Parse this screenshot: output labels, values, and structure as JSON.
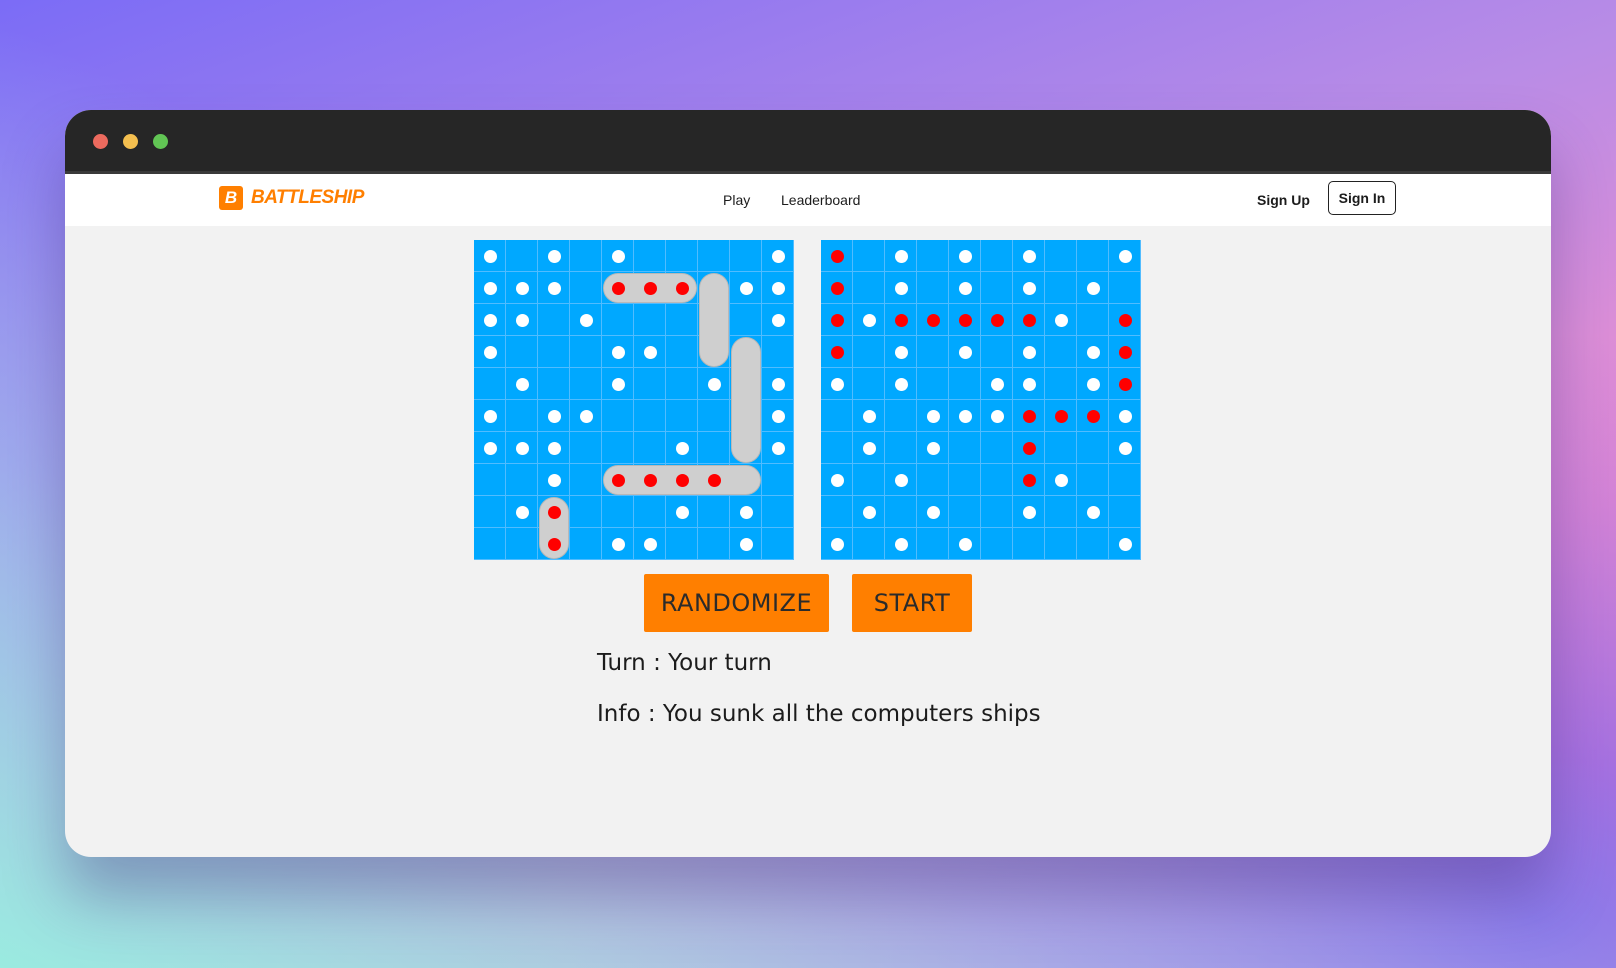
{
  "app": {
    "logo_letter": "B",
    "logo_text": "BATTLESHIP",
    "brand_color": "#ff7f00"
  },
  "nav": {
    "links": [
      "Play",
      "Leaderboard"
    ],
    "sign_up": "Sign Up",
    "sign_in": "Sign In"
  },
  "game": {
    "grid_size": 10,
    "board_color": "#00a8ff",
    "player_board": {
      "ships": [
        {
          "row": 1,
          "col": 4,
          "length": 3,
          "orientation": "horizontal"
        },
        {
          "row": 1,
          "col": 7,
          "length": 3,
          "orientation": "vertical"
        },
        {
          "row": 3,
          "col": 8,
          "length": 4,
          "orientation": "vertical"
        },
        {
          "row": 7,
          "col": 4,
          "length": 5,
          "orientation": "horizontal"
        },
        {
          "row": 8,
          "col": 2,
          "length": 2,
          "orientation": "vertical"
        }
      ],
      "hits": [
        [
          1,
          4
        ],
        [
          1,
          5
        ],
        [
          1,
          6
        ],
        [
          7,
          4
        ],
        [
          7,
          5
        ],
        [
          7,
          6
        ],
        [
          7,
          7
        ],
        [
          8,
          2
        ],
        [
          9,
          2
        ]
      ],
      "misses": [
        [
          0,
          0
        ],
        [
          0,
          2
        ],
        [
          0,
          4
        ],
        [
          0,
          9
        ],
        [
          1,
          0
        ],
        [
          1,
          1
        ],
        [
          1,
          2
        ],
        [
          1,
          8
        ],
        [
          1,
          9
        ],
        [
          2,
          0
        ],
        [
          2,
          1
        ],
        [
          2,
          3
        ],
        [
          2,
          9
        ],
        [
          3,
          0
        ],
        [
          3,
          4
        ],
        [
          3,
          5
        ],
        [
          4,
          1
        ],
        [
          4,
          4
        ],
        [
          4,
          7
        ],
        [
          4,
          9
        ],
        [
          5,
          0
        ],
        [
          5,
          2
        ],
        [
          5,
          3
        ],
        [
          5,
          9
        ],
        [
          6,
          0
        ],
        [
          6,
          1
        ],
        [
          6,
          2
        ],
        [
          6,
          6
        ],
        [
          6,
          9
        ],
        [
          7,
          2
        ],
        [
          8,
          1
        ],
        [
          8,
          6
        ],
        [
          8,
          8
        ],
        [
          9,
          4
        ],
        [
          9,
          5
        ],
        [
          9,
          8
        ]
      ]
    },
    "computer_board": {
      "hits": [
        [
          0,
          0
        ],
        [
          1,
          0
        ],
        [
          2,
          0
        ],
        [
          3,
          0
        ],
        [
          2,
          2
        ],
        [
          2,
          3
        ],
        [
          2,
          4
        ],
        [
          2,
          5
        ],
        [
          2,
          6
        ],
        [
          2,
          9
        ],
        [
          3,
          9
        ],
        [
          4,
          9
        ],
        [
          5,
          6
        ],
        [
          5,
          7
        ],
        [
          5,
          8
        ],
        [
          6,
          6
        ],
        [
          7,
          6
        ]
      ],
      "misses": [
        [
          0,
          2
        ],
        [
          0,
          4
        ],
        [
          0,
          6
        ],
        [
          0,
          9
        ],
        [
          1,
          2
        ],
        [
          1,
          4
        ],
        [
          1,
          6
        ],
        [
          1,
          8
        ],
        [
          2,
          1
        ],
        [
          2,
          7
        ],
        [
          3,
          2
        ],
        [
          3,
          4
        ],
        [
          3,
          6
        ],
        [
          3,
          8
        ],
        [
          4,
          0
        ],
        [
          4,
          2
        ],
        [
          4,
          5
        ],
        [
          4,
          6
        ],
        [
          4,
          8
        ],
        [
          5,
          1
        ],
        [
          5,
          3
        ],
        [
          5,
          4
        ],
        [
          5,
          5
        ],
        [
          5,
          9
        ],
        [
          6,
          1
        ],
        [
          6,
          3
        ],
        [
          6,
          9
        ],
        [
          7,
          0
        ],
        [
          7,
          2
        ],
        [
          7,
          7
        ],
        [
          8,
          1
        ],
        [
          8,
          3
        ],
        [
          8,
          6
        ],
        [
          8,
          8
        ],
        [
          9,
          0
        ],
        [
          9,
          2
        ],
        [
          9,
          4
        ],
        [
          9,
          9
        ]
      ]
    }
  },
  "buttons": {
    "randomize": "RANDOMIZE",
    "start": "START"
  },
  "status": {
    "turn": "Turn : Your turn",
    "info": "Info : You sunk all the computers ships"
  }
}
